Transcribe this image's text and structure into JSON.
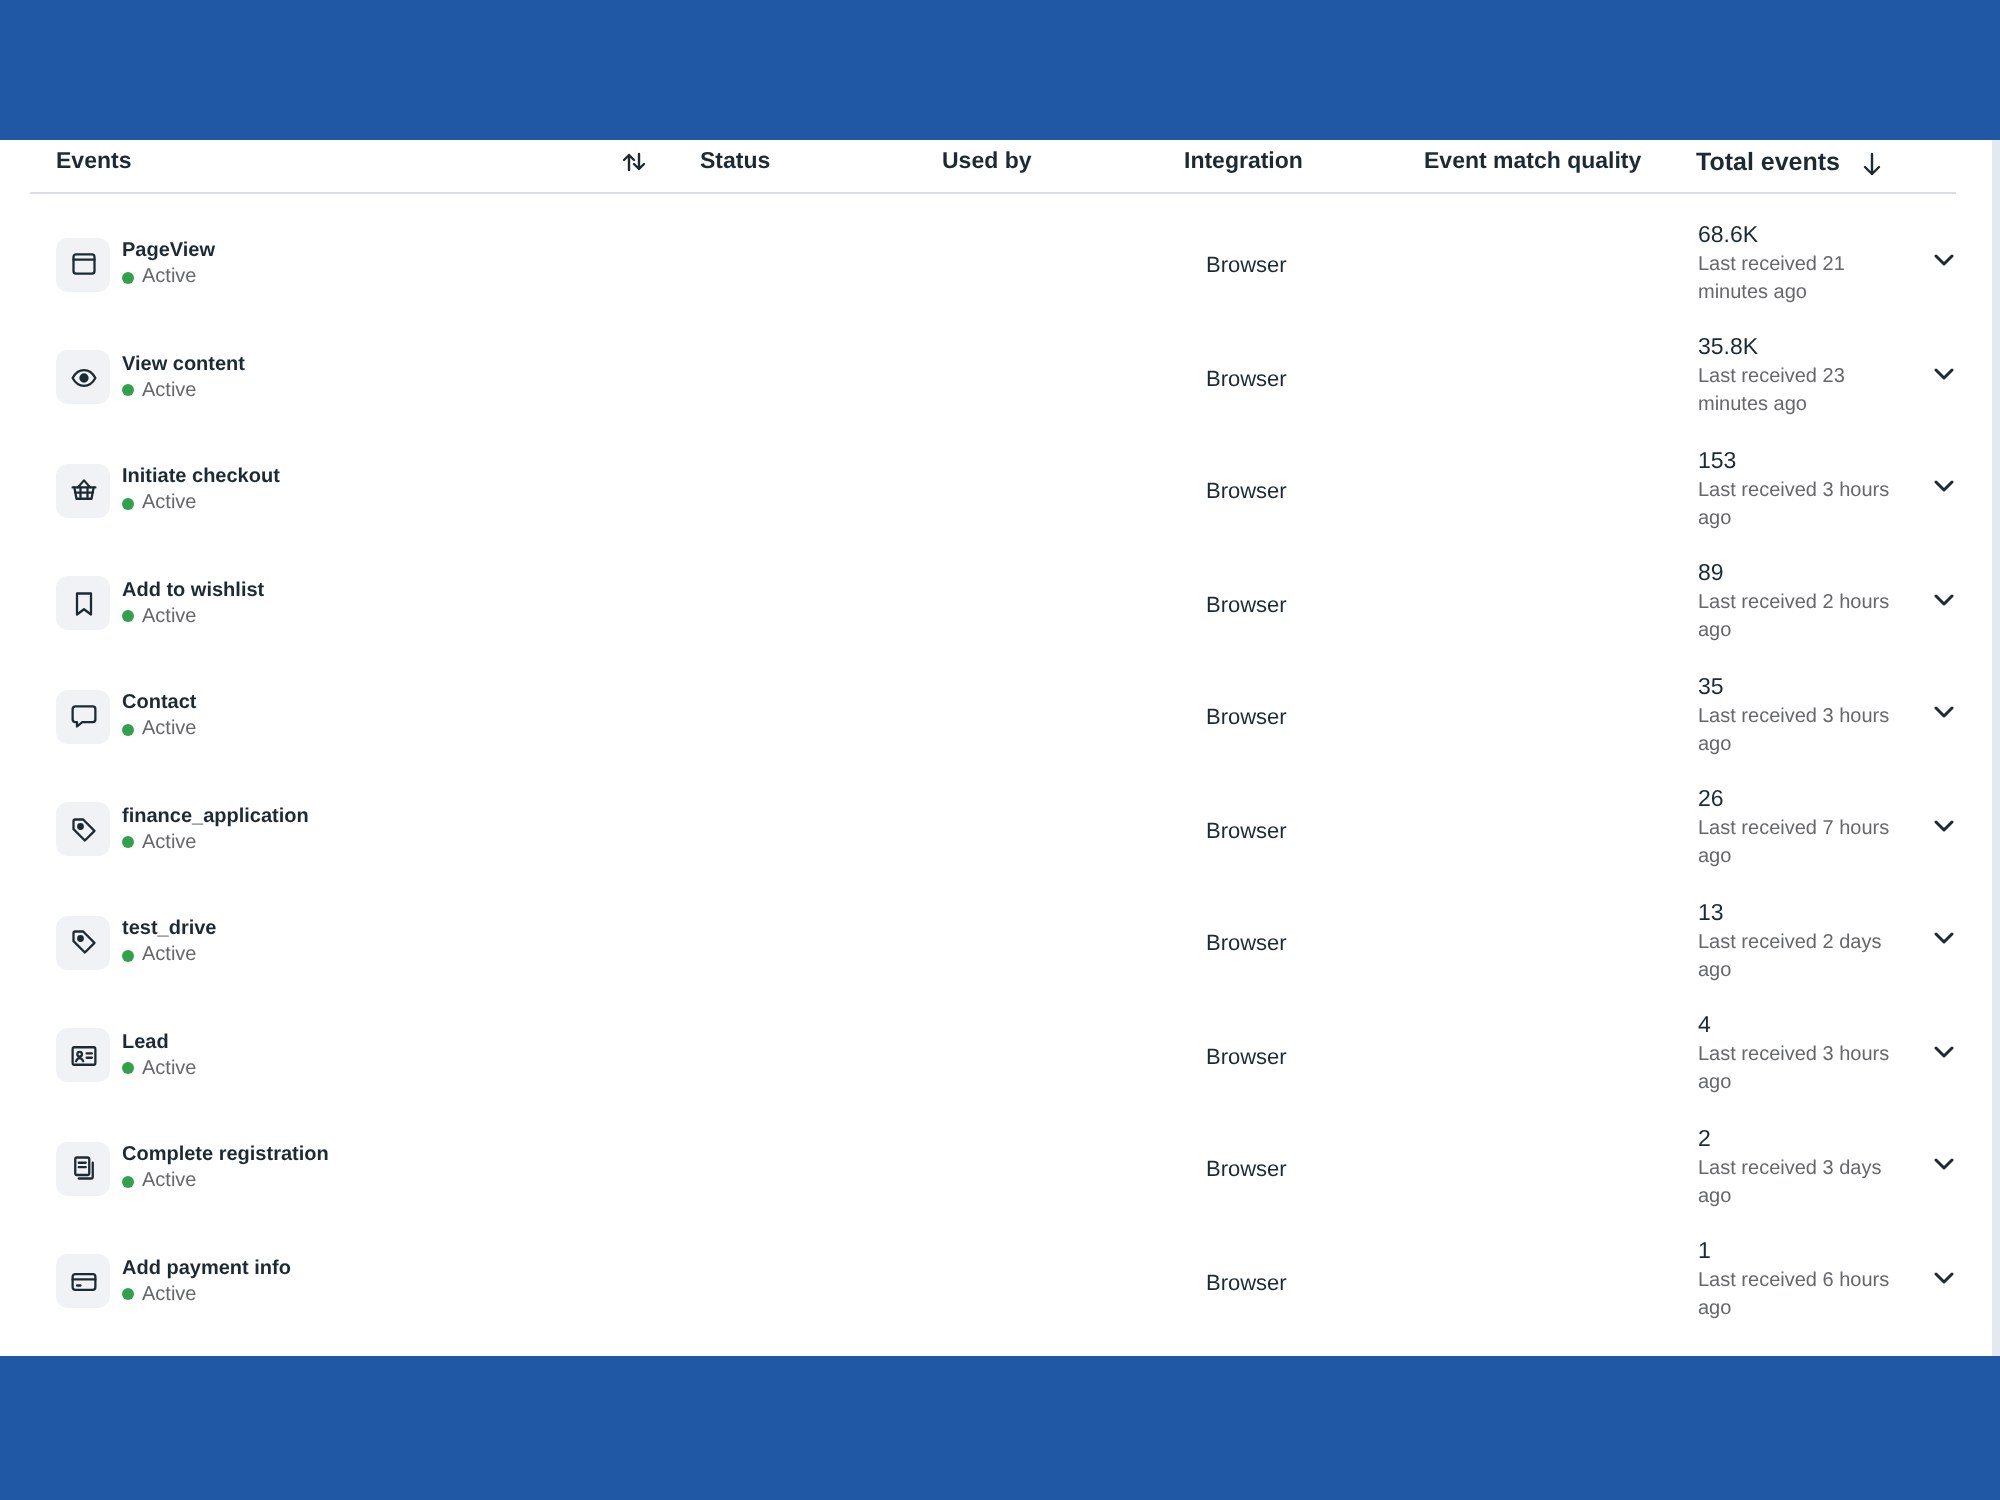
{
  "columns": [
    {
      "label": "Events",
      "sortable": true,
      "sorted": false
    },
    {
      "label": "Status",
      "sortable": false,
      "sorted": false
    },
    {
      "label": "Used by",
      "sortable": false,
      "sorted": false
    },
    {
      "label": "Integration",
      "sortable": false,
      "sorted": false
    },
    {
      "label": "Event match quality",
      "sortable": false,
      "sorted": false
    },
    {
      "label": "Total events",
      "sortable": true,
      "sorted": true
    }
  ],
  "rows": [
    {
      "kind": "browser",
      "name": "PageView",
      "status": "Active",
      "integration": "Browser",
      "total": "68.6K",
      "last_received": "Last received 21 minutes ago",
      "expanded": false
    },
    {
      "kind": "view",
      "name": "View content",
      "status": "Active",
      "integration": "Browser",
      "total": "35.8K",
      "last_received": "Last received 23 minutes ago",
      "expanded": false
    },
    {
      "kind": "checkout",
      "name": "Initiate checkout",
      "status": "Active",
      "integration": "Browser",
      "total": "153",
      "last_received": "Last received 3 hours ago",
      "expanded": false
    },
    {
      "kind": "wishlist",
      "name": "Add to wishlist",
      "status": "Active",
      "integration": "Browser",
      "total": "89",
      "last_received": "Last received 2 hours ago",
      "expanded": false
    },
    {
      "kind": "contact",
      "name": "Contact",
      "status": "Active",
      "integration": "Browser",
      "total": "35",
      "last_received": "Last received 3 hours ago",
      "expanded": false
    },
    {
      "kind": "custom",
      "name": "finance_application",
      "status": "Active",
      "integration": "Browser",
      "total": "26",
      "last_received": "Last received 7 hours ago",
      "expanded": false
    },
    {
      "kind": "custom",
      "name": "test_drive",
      "status": "Active",
      "integration": "Browser",
      "total": "13",
      "last_received": "Last received 2 days ago",
      "expanded": false
    },
    {
      "kind": "lead",
      "name": "Lead",
      "status": "Active",
      "integration": "Browser",
      "total": "4",
      "last_received": "Last received 3 hours ago",
      "expanded": false
    },
    {
      "kind": "registration",
      "name": "Complete registration",
      "status": "Active",
      "integration": "Browser",
      "total": "2",
      "last_received": "Last received 3 days ago",
      "expanded": false
    },
    {
      "kind": "payment",
      "name": "Add payment info",
      "status": "Active",
      "integration": "Browser",
      "total": "1",
      "last_received": "Last received 6 hours ago",
      "expanded": false
    }
  ]
}
